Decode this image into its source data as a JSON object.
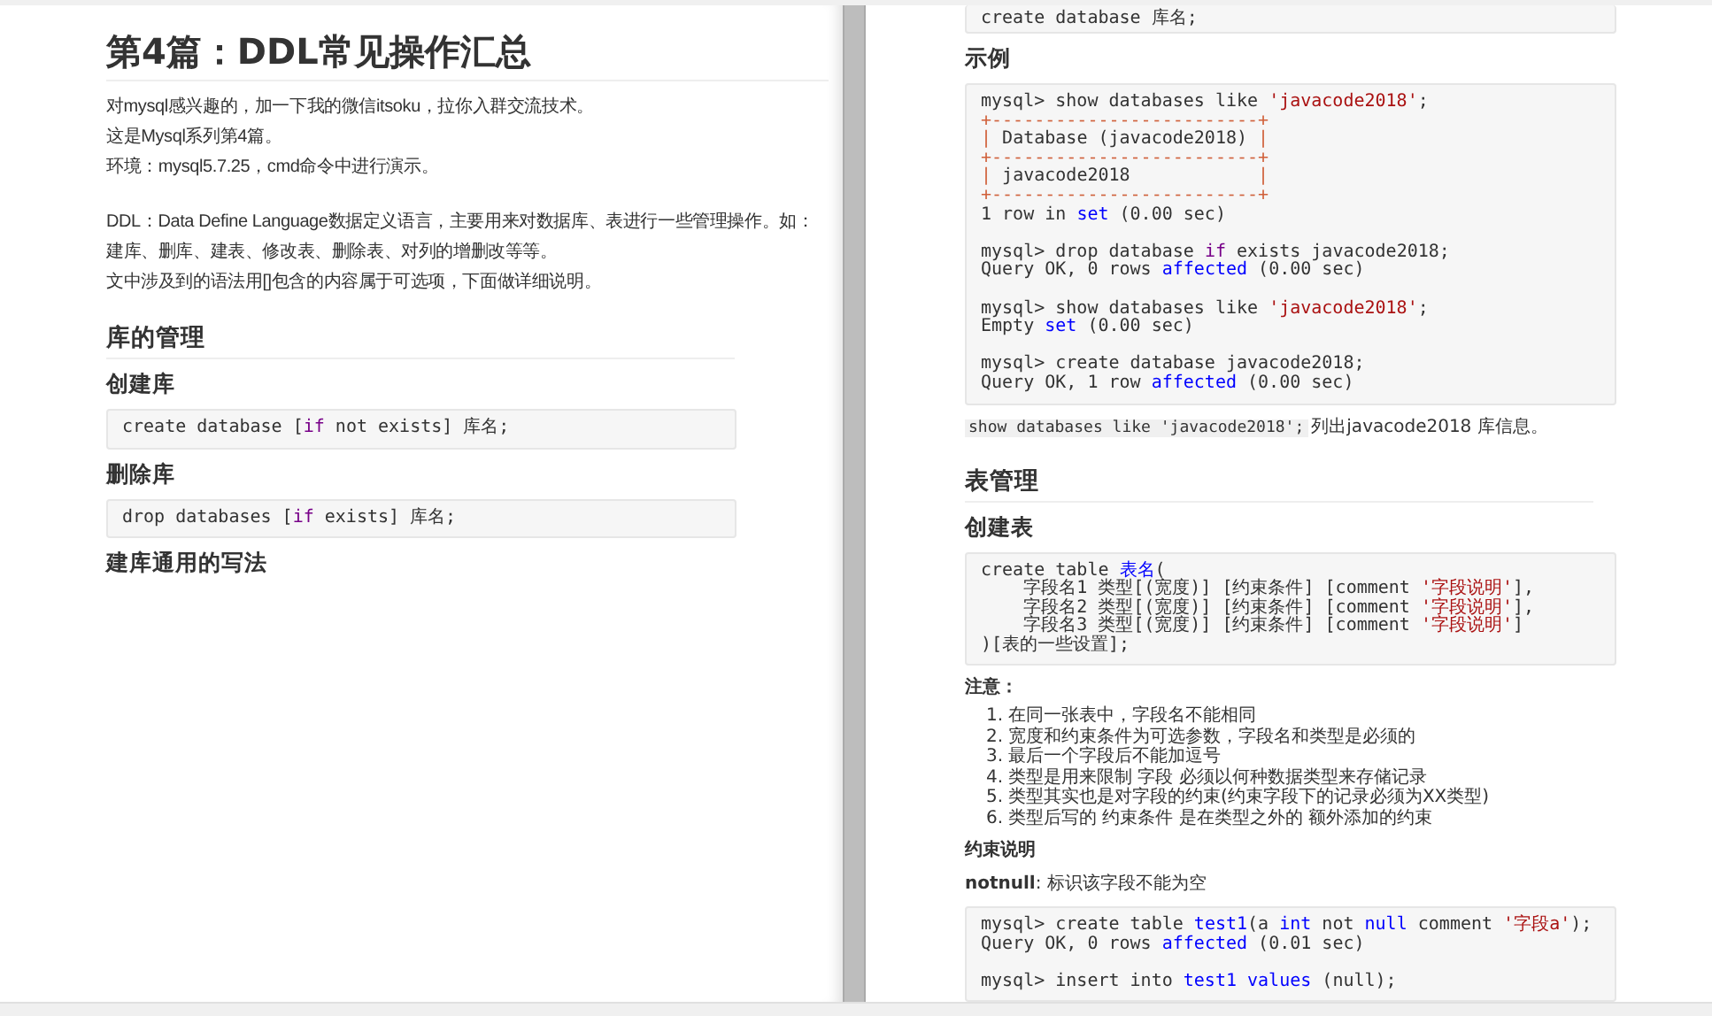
{
  "pages": [
    {
      "blocks": [
        {
          "kind": "title",
          "text": "第4篇：DDL常见操作汇总"
        },
        {
          "kind": "paragraphs",
          "lines": [
            "对mysql感兴趣的，加一下我的微信itsoku，拉你入群交流技术。",
            "这是Mysql系列第4篇。",
            "环境：mysql5.7.25，cmd命令中进行演示。"
          ]
        },
        {
          "kind": "paragraphs",
          "lines": [
            "DDL：Data Define Language数据定义语言，主要用来对数据库、表进行一些管理操作。如：",
            "建库、删库、建表、修改表、删除表、对列的增删改等等。",
            "文中涉及到的语法用[]包含的内容属于可选项，下面做详细说明。"
          ]
        },
        {
          "kind": "h2",
          "text": "库的管理"
        },
        {
          "kind": "h3",
          "text": "创建库"
        },
        {
          "kind": "code",
          "sections": [
            [
              [
                {
                  "text": "create database [",
                  "kind": "plain"
                },
                {
                  "text": "if",
                  "kind": "keyword"
                },
                {
                  "text": " not exists] 库名;",
                  "kind": "plain"
                }
              ]
            ]
          ]
        },
        {
          "kind": "h3",
          "text": "删除库"
        },
        {
          "kind": "code",
          "sections": [
            [
              [
                {
                  "text": "drop databases [",
                  "kind": "plain"
                },
                {
                  "text": "if",
                  "kind": "keyword"
                },
                {
                  "text": " exists] 库名;",
                  "kind": "plain"
                }
              ]
            ]
          ]
        },
        {
          "kind": "h3",
          "text": "建库通用的写法"
        }
      ]
    },
    {
      "blocks": [
        {
          "kind": "code_clipped",
          "sections": [
            [
              [
                {
                  "text": "create database 库名;",
                  "kind": "plain"
                }
              ]
            ]
          ]
        },
        {
          "kind": "h3",
          "text": "示例"
        },
        {
          "kind": "code",
          "sections": [
            [
              [
                {
                  "text": "mysql> show databases like ",
                  "kind": "plain"
                },
                {
                  "text": "'javacode2018'",
                  "kind": "string"
                },
                {
                  "text": ";",
                  "kind": "plain"
                }
              ],
              [
                {
                  "text": "+-------------------------+",
                  "kind": "operator"
                }
              ],
              [
                {
                  "text": "| ",
                  "kind": "operator"
                },
                {
                  "text": "Database (javacode2018) ",
                  "kind": "plain"
                },
                {
                  "text": "|",
                  "kind": "operator"
                }
              ],
              [
                {
                  "text": "+-------------------------+",
                  "kind": "operator"
                }
              ],
              [
                {
                  "text": "| ",
                  "kind": "operator"
                },
                {
                  "text": "javacode2018            ",
                  "kind": "plain"
                },
                {
                  "text": "|",
                  "kind": "operator"
                }
              ],
              [
                {
                  "text": "+-------------------------+",
                  "kind": "operator"
                }
              ],
              [
                {
                  "text": "1 row in ",
                  "kind": "plain"
                },
                {
                  "text": "set",
                  "kind": "builtin"
                },
                {
                  "text": " (0.00 sec)",
                  "kind": "plain"
                }
              ]
            ],
            [
              [
                {
                  "text": "mysql> drop database ",
                  "kind": "plain"
                },
                {
                  "text": "if",
                  "kind": "keyword"
                },
                {
                  "text": " exists javacode2018;",
                  "kind": "plain"
                }
              ],
              [
                {
                  "text": "Query OK, 0 rows ",
                  "kind": "plain"
                },
                {
                  "text": "affected",
                  "kind": "builtin"
                },
                {
                  "text": " (0.00 sec)",
                  "kind": "plain"
                }
              ]
            ],
            [
              [
                {
                  "text": "mysql> show databases like ",
                  "kind": "plain"
                },
                {
                  "text": "'javacode2018'",
                  "kind": "string"
                },
                {
                  "text": ";",
                  "kind": "plain"
                }
              ],
              [
                {
                  "text": "Empty ",
                  "kind": "plain"
                },
                {
                  "text": "set",
                  "kind": "builtin"
                },
                {
                  "text": " (0.00 sec)",
                  "kind": "plain"
                }
              ]
            ],
            [
              [
                {
                  "text": "mysql> create database javacode2018;",
                  "kind": "plain"
                }
              ],
              [
                {
                  "text": "Query OK, 1 row ",
                  "kind": "plain"
                },
                {
                  "text": "affected",
                  "kind": "builtin"
                },
                {
                  "text": " (0.00 sec)",
                  "kind": "plain"
                }
              ]
            ]
          ]
        },
        {
          "kind": "inline_note",
          "code": "show databases like 'javacode2018';",
          "text": "列出javacode2018 库信息。"
        },
        {
          "kind": "h2",
          "text": "表管理"
        },
        {
          "kind": "h3",
          "text": "创建表"
        },
        {
          "kind": "code",
          "sections": [
            [
              [
                {
                  "text": "create table ",
                  "kind": "plain"
                },
                {
                  "text": "表名",
                  "kind": "builtin"
                },
                {
                  "text": "(",
                  "kind": "plain"
                }
              ],
              [
                {
                  "text": "    字段名1 类型[(宽度)] [约束条件] [comment ",
                  "kind": "plain"
                },
                {
                  "text": "'字段说明'",
                  "kind": "string"
                },
                {
                  "text": "],",
                  "kind": "plain"
                }
              ],
              [
                {
                  "text": "    字段名2 类型[(宽度)] [约束条件] [comment ",
                  "kind": "plain"
                },
                {
                  "text": "'字段说明'",
                  "kind": "string"
                },
                {
                  "text": "],",
                  "kind": "plain"
                }
              ],
              [
                {
                  "text": "    字段名3 类型[(宽度)] [约束条件] [comment ",
                  "kind": "plain"
                },
                {
                  "text": "'字段说明'",
                  "kind": "string"
                },
                {
                  "text": "]",
                  "kind": "plain"
                }
              ],
              [
                {
                  "text": ")[表的一些设置];",
                  "kind": "plain"
                }
              ]
            ]
          ]
        },
        {
          "kind": "label",
          "text": "注意："
        },
        {
          "kind": "ordered_list",
          "items": [
            {
              "number": "1.",
              "text": "在同一张表中，字段名不能相同"
            },
            {
              "number": "2.",
              "text": "宽度和约束条件为可选参数，字段名和类型是必须的"
            },
            {
              "number": "3.",
              "text": "最后一个字段后不能加逗号"
            },
            {
              "number": "4.",
              "text": "类型是用来限制 字段 必须以何种数据类型来存储记录"
            },
            {
              "number": "5.",
              "text": "类型其实也是对字段的约束(约束字段下的记录必须为XX类型)"
            },
            {
              "number": "6.",
              "text": "类型后写的 约束条件 是在类型之外的 额外添加的约束"
            }
          ]
        },
        {
          "kind": "label",
          "text": "约束说明"
        },
        {
          "kind": "rich",
          "text": "**notnull**: 标识该字段不能为空"
        },
        {
          "kind": "code",
          "sections": [
            [
              [
                {
                  "text": "mysql> create table ",
                  "kind": "plain"
                },
                {
                  "text": "test1",
                  "kind": "builtin"
                },
                {
                  "text": "(a ",
                  "kind": "plain"
                },
                {
                  "text": "int",
                  "kind": "builtin"
                },
                {
                  "text": " not ",
                  "kind": "plain"
                },
                {
                  "text": "null",
                  "kind": "builtin"
                },
                {
                  "text": " comment ",
                  "kind": "plain"
                },
                {
                  "text": "'字段a'",
                  "kind": "string"
                },
                {
                  "text": ");",
                  "kind": "plain"
                }
              ],
              [
                {
                  "text": "Query OK, 0 rows ",
                  "kind": "plain"
                },
                {
                  "text": "affected",
                  "kind": "builtin"
                },
                {
                  "text": " (0.01 sec)",
                  "kind": "plain"
                }
              ]
            ],
            [
              [
                {
                  "text": "mysql> insert into ",
                  "kind": "plain"
                },
                {
                  "text": "test1",
                  "kind": "builtin"
                },
                {
                  "text": " values",
                  "kind": "builtin"
                },
                {
                  "text": " (null);",
                  "kind": "plain"
                }
              ]
            ]
          ]
        }
      ]
    }
  ]
}
